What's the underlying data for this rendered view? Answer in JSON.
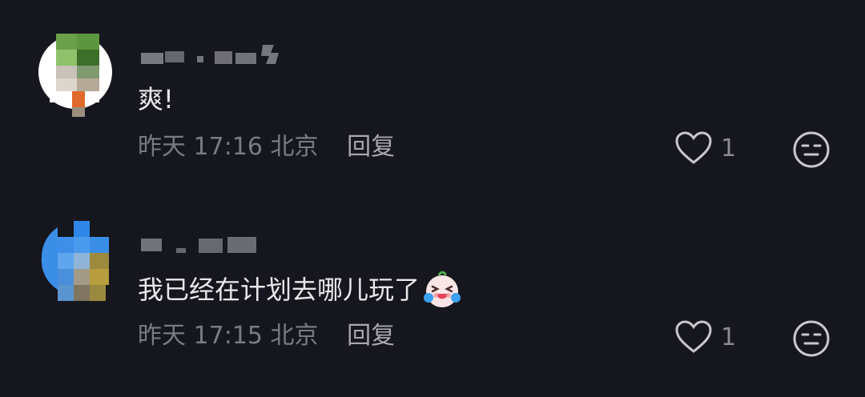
{
  "comments": [
    {
      "text": "爽!",
      "time": "昨天 17:16",
      "location": "北京",
      "reply_label": "回复",
      "like_count": "1",
      "avatar_icon": "pixelated-avatar-icon"
    },
    {
      "text": "我已经在计划去哪儿玩了",
      "time": "昨天 17:15",
      "location": "北京",
      "reply_label": "回复",
      "like_count": "1",
      "avatar_icon": "pixelated-avatar-icon",
      "emoji_icon": "laughing-crying-emoji-icon"
    }
  ],
  "colors": {
    "background": "#16161e",
    "text": "#e8e8ea",
    "meta": "#7a7a82"
  }
}
